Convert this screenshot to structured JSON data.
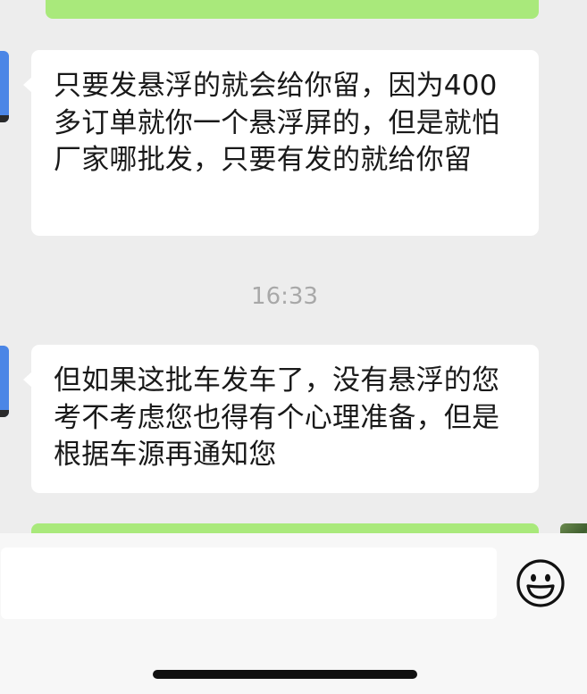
{
  "conversation": {
    "messages": [
      {
        "direction": "received",
        "text": "只要发悬浮的就会给你留，因为400多订单就你一个悬浮屏的，但是就怕厂家哪批发，只要有发的就给你留"
      },
      {
        "direction": "received",
        "text": "但如果这批车发车了，没有悬浮的您考不考虑您也得有个心理准备，但是根据车源再通知您"
      }
    ],
    "timestamp": "16:33"
  },
  "input": {
    "value": "",
    "emoji_icon": "smile-emoji-icon"
  },
  "colors": {
    "background": "#ededed",
    "sent_bubble": "#a9e97b",
    "received_bubble": "#ffffff",
    "timestamp_text": "#a8a8a8"
  }
}
